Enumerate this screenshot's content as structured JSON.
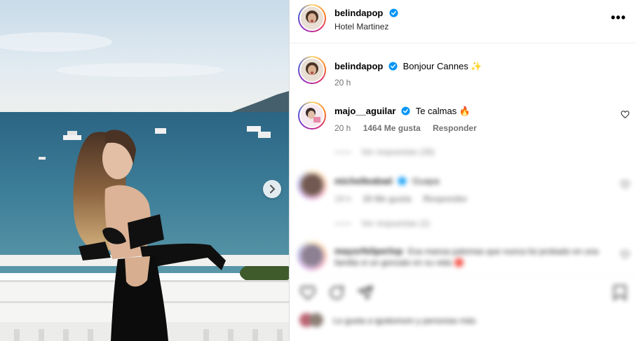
{
  "header": {
    "username": "belindapop",
    "location": "Hotel Martinez",
    "more_label": "•••"
  },
  "caption": {
    "username": "belindapop",
    "text": "Bonjour Cannes ✨",
    "time": "20 h"
  },
  "comments": [
    {
      "username": "majo__aguilar",
      "text": "Te calmas 🔥",
      "time": "20 h",
      "likes": "1464 Me gusta",
      "reply": "Responder",
      "view_replies": "Ver respuestas (28)"
    },
    {
      "username": "michelleabad",
      "text": "Guapa",
      "time": "19 h",
      "likes": "20 Me gusta",
      "reply": "Responder",
      "view_replies": "Ver respuestas (2)"
    },
    {
      "username": "mayorfeliperlop",
      "text": "Esa mansa palomas que nunca fui probado en una familia si un gonzalo en su vida 🔴"
    }
  ],
  "likes": {
    "text": "Le gusta a igodomom y personas más"
  },
  "colors": {
    "verified": "#0095f6",
    "muted": "#737373",
    "border": "#dbdbdb"
  },
  "icons": [
    "verified-icon",
    "heart-icon",
    "comment-icon",
    "share-icon",
    "bookmark-icon",
    "chevron-right-icon",
    "more-icon"
  ]
}
